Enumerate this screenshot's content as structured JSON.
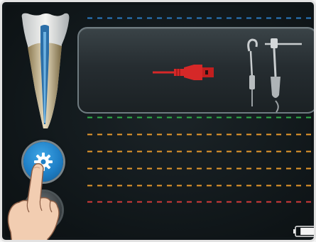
{
  "screen": {
    "title": "",
    "icons": [
      "tooth-icon",
      "usb-plug-icon",
      "probe-clip-icon",
      "probe-holder-icon",
      "gear-icon",
      "hand-pointer-icon",
      "battery-icon"
    ]
  },
  "colors": {
    "background": "#12191c",
    "panel_border": "#6f7b80",
    "usb_red": "#d62828",
    "settings_blue": "#1f7fc6",
    "scale_blue": "#2b7cc4",
    "scale_green": "#2fb24a",
    "scale_orange": "#e89a2c",
    "scale_red": "#d63a3a"
  },
  "apex_scale": {
    "lines": [
      "blue",
      "green",
      "orange",
      "orange",
      "orange",
      "orange",
      "red"
    ]
  },
  "battery": {
    "level": 0.8
  }
}
